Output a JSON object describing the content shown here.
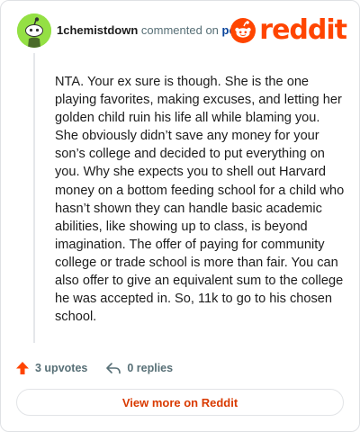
{
  "header": {
    "username": "1chemistdown",
    "action_text": "commented on",
    "post_link": "post",
    "logo_text": "reddit",
    "avatar_icon": "snoo-avatar-icon",
    "brand_color": "#ff4500"
  },
  "comment": {
    "text": "NTA. Your ex sure is though. She is the one playing favorites, making excuses, and letting her golden child ruin his life all while blaming you. She obviously didn’t save any money for your son’s college and decided to put everything on you. Why she expects you to shell out Harvard money on a bottom feeding school for a child who hasn’t shown they can handle basic academic abilities, like showing up to class, is beyond imagination. The offer of paying for community college or trade school is more than fair. You can also offer to give an equivalent sum to the college he was accepted in. So, 11k to go to his chosen school."
  },
  "footer": {
    "upvotes": "3 upvotes",
    "replies": "0 replies",
    "upvote_icon": "upvote-arrow-icon",
    "reply_icon": "reply-arrow-icon"
  },
  "cta": {
    "view_more": "View more on Reddit",
    "color": "#d93a00"
  }
}
